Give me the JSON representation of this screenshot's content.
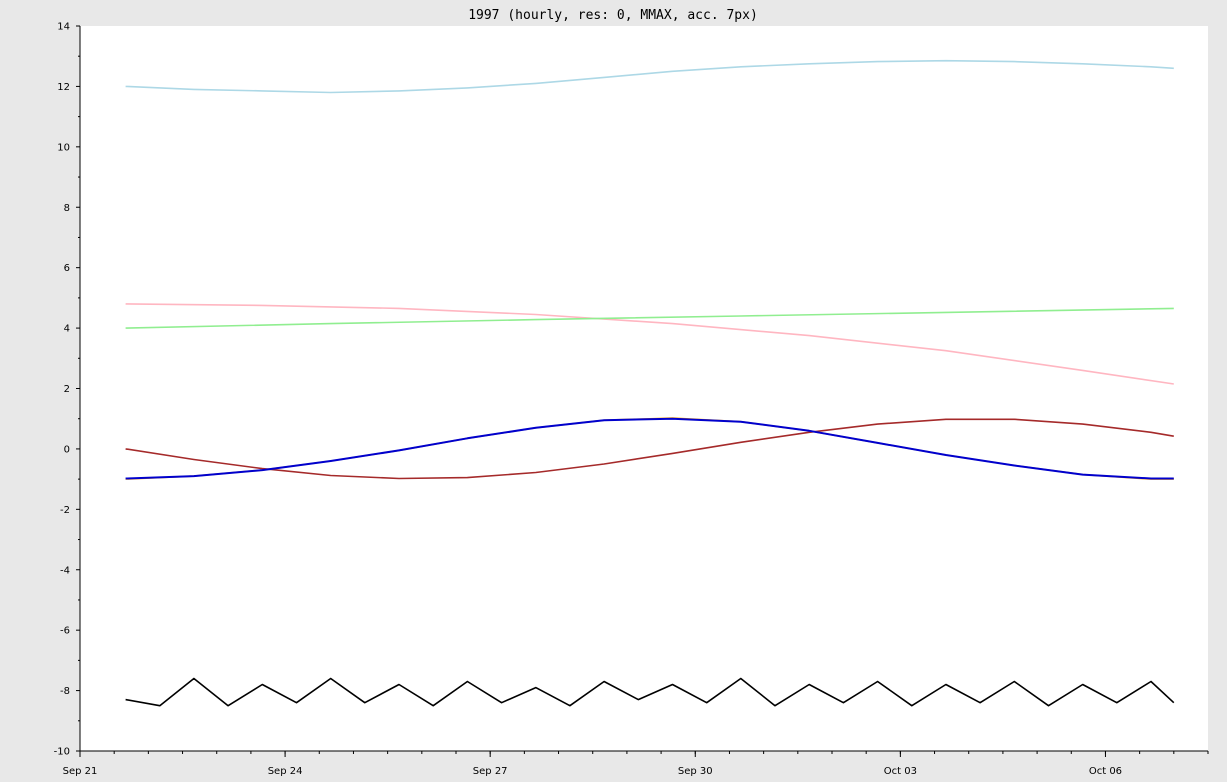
{
  "chart_data": {
    "type": "line",
    "title": "1997 (hourly, res: 0, MMAX, acc. 7px)",
    "xlabel": "",
    "ylabel": "",
    "x_range": [
      "1997-09-21T00:00",
      "1997-10-07T12:00"
    ],
    "ylim": [
      -10,
      14
    ],
    "y_ticks": [
      -10,
      -8,
      -6,
      -4,
      -2,
      0,
      2,
      4,
      6,
      8,
      10,
      12,
      14
    ],
    "x_ticks": [
      {
        "date": "1997-09-21T00:00",
        "label": "Sep 21"
      },
      {
        "date": "1997-09-24T00:00",
        "label": "Sep 24"
      },
      {
        "date": "1997-09-27T00:00",
        "label": "Sep 27"
      },
      {
        "date": "1997-09-30T00:00",
        "label": "Sep 30"
      },
      {
        "date": "1997-10-03T00:00",
        "label": "Oct 03"
      },
      {
        "date": "1997-10-06T00:00",
        "label": "Oct 06"
      }
    ],
    "grid": false,
    "series": [
      {
        "color": "#add8e6",
        "x": [
          "1997-09-21T16:00",
          "1997-09-22T16:00",
          "1997-09-23T16:00",
          "1997-09-24T16:00",
          "1997-09-25T16:00",
          "1997-09-26T16:00",
          "1997-09-27T16:00",
          "1997-09-28T16:00",
          "1997-09-29T16:00",
          "1997-09-30T16:00",
          "1997-10-01T16:00",
          "1997-10-02T16:00",
          "1997-10-03T16:00",
          "1997-10-04T16:00",
          "1997-10-05T16:00",
          "1997-10-06T16:00",
          "1997-10-07T00:00"
        ],
        "y": [
          12.0,
          11.9,
          11.85,
          11.8,
          11.85,
          11.95,
          12.1,
          12.3,
          12.5,
          12.65,
          12.75,
          12.82,
          12.85,
          12.82,
          12.75,
          12.65,
          12.6
        ]
      },
      {
        "color": "#ffb6c1",
        "x": [
          "1997-09-21T16:00",
          "1997-09-23T16:00",
          "1997-09-25T16:00",
          "1997-09-27T16:00",
          "1997-09-29T16:00",
          "1997-10-01T16:00",
          "1997-10-03T16:00",
          "1997-10-05T16:00",
          "1997-10-07T00:00"
        ],
        "y": [
          4.8,
          4.75,
          4.65,
          4.45,
          4.15,
          3.75,
          3.25,
          2.6,
          2.15
        ]
      },
      {
        "color": "#90ee90",
        "x": [
          "1997-09-21T16:00",
          "1997-09-24T16:00",
          "1997-09-27T16:00",
          "1997-09-30T16:00",
          "1997-10-03T16:00",
          "1997-10-07T00:00"
        ],
        "y": [
          4.0,
          4.15,
          4.28,
          4.4,
          4.52,
          4.65
        ]
      },
      {
        "color": "#a52a2a",
        "x": [
          "1997-09-21T16:00",
          "1997-09-22T16:00",
          "1997-09-23T16:00",
          "1997-09-24T16:00",
          "1997-09-25T16:00",
          "1997-09-26T16:00",
          "1997-09-27T16:00",
          "1997-09-28T16:00",
          "1997-09-29T16:00",
          "1997-09-30T16:00",
          "1997-10-01T16:00",
          "1997-10-02T16:00",
          "1997-10-03T16:00",
          "1997-10-04T16:00",
          "1997-10-05T16:00",
          "1997-10-06T16:00",
          "1997-10-07T00:00"
        ],
        "y": [
          0.0,
          -0.35,
          -0.65,
          -0.88,
          -0.98,
          -0.95,
          -0.78,
          -0.5,
          -0.15,
          0.22,
          0.55,
          0.82,
          0.98,
          0.98,
          0.82,
          0.55,
          0.42
        ]
      },
      {
        "color": "#ffa500",
        "x": [
          "1997-09-21T16:00",
          "1997-09-22T16:00",
          "1997-09-23T16:00",
          "1997-09-24T16:00",
          "1997-09-25T16:00",
          "1997-09-26T16:00",
          "1997-09-27T16:00",
          "1997-09-28T16:00",
          "1997-09-29T16:00",
          "1997-09-30T16:00",
          "1997-10-01T16:00",
          "1997-10-02T16:00",
          "1997-10-03T16:00",
          "1997-10-04T16:00",
          "1997-10-05T16:00",
          "1997-10-06T16:00",
          "1997-10-07T00:00"
        ],
        "y": [
          -1.0,
          -0.9,
          -0.7,
          -0.4,
          -0.05,
          0.35,
          0.7,
          0.95,
          1.02,
          0.9,
          0.6,
          0.2,
          -0.2,
          -0.55,
          -0.85,
          -1.0,
          -1.0
        ]
      },
      {
        "color": "#0000cd",
        "x": [
          "1997-09-21T16:00",
          "1997-09-22T16:00",
          "1997-09-23T16:00",
          "1997-09-24T16:00",
          "1997-09-25T16:00",
          "1997-09-26T16:00",
          "1997-09-27T16:00",
          "1997-09-28T16:00",
          "1997-09-29T16:00",
          "1997-09-30T16:00",
          "1997-10-01T16:00",
          "1997-10-02T16:00",
          "1997-10-03T16:00",
          "1997-10-04T16:00",
          "1997-10-05T16:00",
          "1997-10-06T16:00",
          "1997-10-07T00:00"
        ],
        "y": [
          -0.98,
          -0.9,
          -0.7,
          -0.4,
          -0.05,
          0.35,
          0.7,
          0.95,
          1.0,
          0.9,
          0.6,
          0.2,
          -0.2,
          -0.55,
          -0.85,
          -0.98,
          -0.98
        ]
      },
      {
        "color": "#000000",
        "x": [
          "1997-09-21T16:00",
          "1997-09-22T04:00",
          "1997-09-22T16:00",
          "1997-09-23T04:00",
          "1997-09-23T16:00",
          "1997-09-24T04:00",
          "1997-09-24T16:00",
          "1997-09-25T04:00",
          "1997-09-25T16:00",
          "1997-09-26T04:00",
          "1997-09-26T16:00",
          "1997-09-27T04:00",
          "1997-09-27T16:00",
          "1997-09-28T04:00",
          "1997-09-28T16:00",
          "1997-09-29T04:00",
          "1997-09-29T16:00",
          "1997-09-30T04:00",
          "1997-09-30T16:00",
          "1997-10-01T04:00",
          "1997-10-01T16:00",
          "1997-10-02T04:00",
          "1997-10-02T16:00",
          "1997-10-03T04:00",
          "1997-10-03T16:00",
          "1997-10-04T04:00",
          "1997-10-04T16:00",
          "1997-10-05T04:00",
          "1997-10-05T16:00",
          "1997-10-06T04:00",
          "1997-10-06T16:00",
          "1997-10-07T00:00"
        ],
        "y": [
          -8.3,
          -8.5,
          -7.6,
          -8.5,
          -7.8,
          -8.4,
          -7.6,
          -8.4,
          -7.8,
          -8.5,
          -7.7,
          -8.4,
          -7.9,
          -8.5,
          -7.7,
          -8.3,
          -7.8,
          -8.4,
          -7.6,
          -8.5,
          -7.8,
          -8.4,
          -7.7,
          -8.5,
          -7.8,
          -8.4,
          -7.7,
          -8.5,
          -7.8,
          -8.4,
          -7.7,
          -8.4
        ]
      }
    ]
  }
}
